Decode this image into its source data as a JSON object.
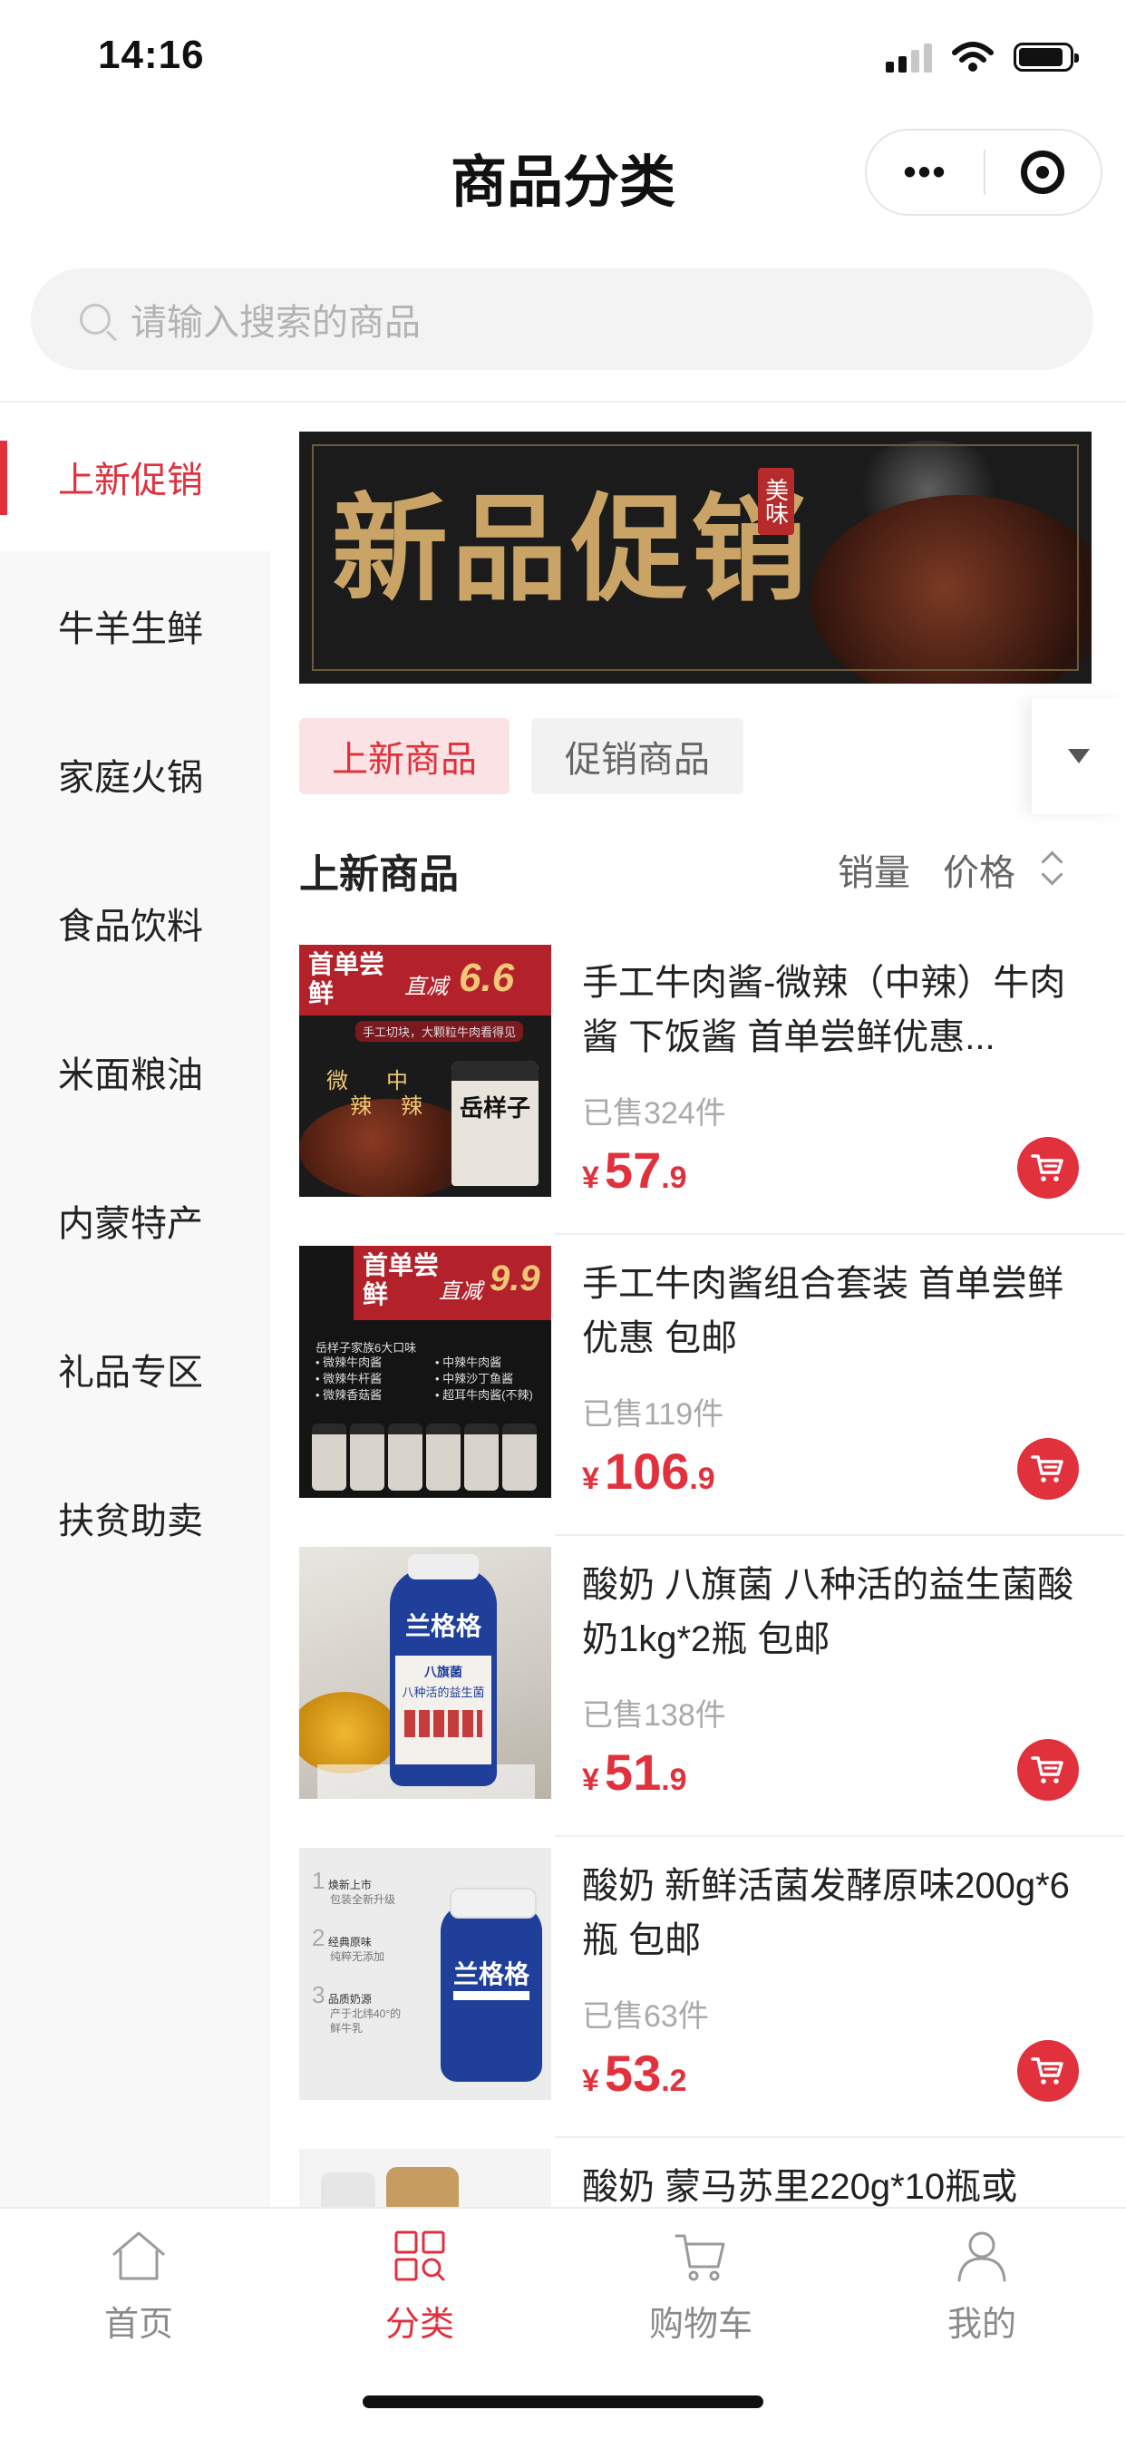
{
  "status_bar": {
    "time": "14:16"
  },
  "nav": {
    "title": "商品分类",
    "more_glyph": "•••"
  },
  "search": {
    "placeholder": "请输入搜索的商品"
  },
  "sidebar": {
    "items": [
      {
        "label": "上新促销",
        "active": true
      },
      {
        "label": "牛羊生鲜"
      },
      {
        "label": "家庭火锅"
      },
      {
        "label": "食品饮料"
      },
      {
        "label": "米面粮油"
      },
      {
        "label": "内蒙特产"
      },
      {
        "label": "礼品专区"
      },
      {
        "label": "扶贫助卖"
      }
    ]
  },
  "banner": {
    "text": "新品促销",
    "seal": "美味"
  },
  "tabs": [
    {
      "label": "上新商品",
      "active": true
    },
    {
      "label": "促销商品"
    }
  ],
  "section": {
    "title": "上新商品",
    "sort_sales": "销量",
    "sort_price": "价格"
  },
  "products": [
    {
      "name": "手工牛肉酱-微辣（中辣）牛肉酱 下饭酱 首单尝鲜优惠...",
      "sold": "已售324件",
      "currency": "¥",
      "price_int": "57",
      "price_dec": ".9",
      "thumb": {
        "badge": "首单尝鲜",
        "tag": "直减",
        "amount": "6.6",
        "sub": "手工切块，大颗粒牛肉看得见",
        "words": [
          "微",
          "辣",
          "中",
          "辣"
        ],
        "jar": "岳样子"
      }
    },
    {
      "name": "手工牛肉酱组合套装 首单尝鲜优惠 包邮",
      "sold": "已售119件",
      "currency": "¥",
      "price_int": "106",
      "price_dec": ".9",
      "thumb": {
        "badge": "首单尝鲜",
        "tag": "直减",
        "amount": "9.9",
        "sub": "岳样子家族6大口味",
        "list_left": [
          "• 微辣牛肉酱",
          "• 微辣牛杆酱",
          "• 微辣香菇酱"
        ],
        "list_right": [
          "• 中辣牛肉酱",
          "• 中辣沙丁鱼酱",
          "• 超耳牛肉酱(不辣)"
        ]
      }
    },
    {
      "name": "酸奶 八旗菌 八种活的益生菌酸奶1kg*2瓶 包邮",
      "sold": "已售138件",
      "currency": "¥",
      "price_int": "51",
      "price_dec": ".9",
      "thumb": {
        "brand": "兰格格",
        "sub": "八旗菌",
        "line": "八种活的益生菌"
      }
    },
    {
      "name": "酸奶 新鲜活菌发酵原味200g*6瓶 包邮",
      "sold": "已售63件",
      "currency": "¥",
      "price_int": "53",
      "price_dec": ".2",
      "thumb": {
        "brand": "兰格格",
        "features": [
          {
            "n": "1",
            "t": "焕新上市",
            "s": "包装全新升级"
          },
          {
            "n": "2",
            "t": "经典原味",
            "s": "纯粹无添加"
          },
          {
            "n": "3",
            "t": "品质奶源",
            "s": "产于北纬40°的鲜牛乳"
          }
        ]
      }
    },
    {
      "name": "酸奶 蒙马苏里220g*10瓶或",
      "sold": "",
      "currency": "",
      "price_int": "",
      "price_dec": "",
      "thumb": {}
    }
  ],
  "tabbar": [
    {
      "label": "首页",
      "icon": "home-icon"
    },
    {
      "label": "分类",
      "icon": "category-icon",
      "active": true
    },
    {
      "label": "购物车",
      "icon": "cart-icon"
    },
    {
      "label": "我的",
      "icon": "user-icon"
    }
  ],
  "colors": {
    "accent": "#e0313d",
    "sidebar_bg": "#f8f8f8",
    "inactive": "#8a8a8a"
  }
}
